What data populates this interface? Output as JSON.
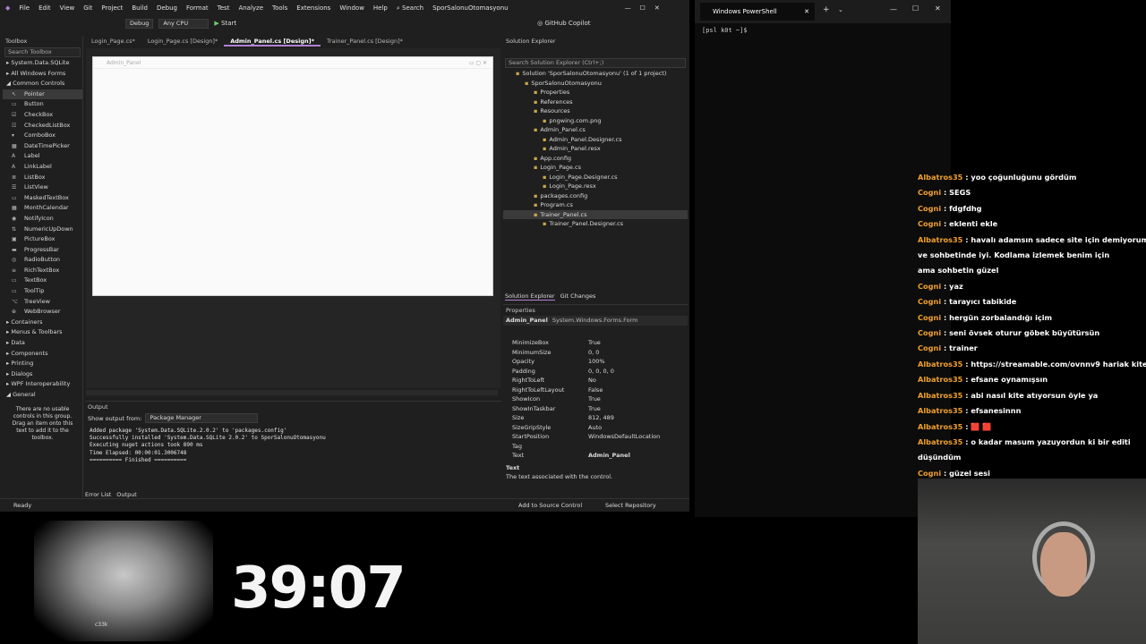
{
  "menu": {
    "items": [
      "File",
      "Edit",
      "View",
      "Git",
      "Project",
      "Build",
      "Debug",
      "Format",
      "Test",
      "Analyze",
      "Tools",
      "Extensions",
      "Window",
      "Help"
    ],
    "search": "Search",
    "solution": "SporSalonuOtomasyonu"
  },
  "toolbar": {
    "config": "Debug",
    "platform": "Any CPU",
    "start": "Start",
    "copilot": "GitHub Copilot"
  },
  "toolbox": {
    "title": "Toolbox",
    "search": "Search Toolbox",
    "categories_top": [
      "System.Data.SQLite",
      "All Windows Forms",
      "Common Controls"
    ],
    "items": [
      "Pointer",
      "Button",
      "CheckBox",
      "CheckedListBox",
      "ComboBox",
      "DateTimePicker",
      "Label",
      "LinkLabel",
      "ListBox",
      "ListView",
      "MaskedTextBox",
      "MonthCalendar",
      "NotifyIcon",
      "NumericUpDown",
      "PictureBox",
      "ProgressBar",
      "RadioButton",
      "RichTextBox",
      "TextBox",
      "ToolTip",
      "TreeView",
      "WebBrowser"
    ],
    "categories_bottom": [
      "Containers",
      "Menus & Toolbars",
      "Data",
      "Components",
      "Printing",
      "Dialogs",
      "WPF Interoperability",
      "General"
    ],
    "empty_msg": "There are no usable controls in this group. Drag an item onto this text to add it to the toolbox."
  },
  "tabs": [
    "Login_Page.cs*",
    "Login_Page.cs [Design]*",
    "Admin_Panel.cs [Design]*",
    "Trainer_Panel.cs [Design]*"
  ],
  "form": {
    "title": "Admin_Panel"
  },
  "output": {
    "title": "Output",
    "show_from_label": "Show output from:",
    "source": "Package Manager",
    "lines": [
      "Added package 'System.Data.SQLite.2.0.2' to 'packages.config'",
      "Successfully installed 'System.Data.SQLite 2.0.2' to SporSalonuOtomasyonu",
      "Executing nuget actions took 890 ms",
      "Time Elapsed: 00:00:01.3006748",
      "========== Finished =========="
    ],
    "bottom_tabs": [
      "Error List",
      "Output"
    ]
  },
  "solution_explorer": {
    "title": "Solution Explorer",
    "search": "Search Solution Explorer (Ctrl+;)",
    "nodes": [
      [
        "Solution 'SporSalonuOtomasyonu' (1 of 1 project)",
        1
      ],
      [
        "SporSalonuOtomasyonu",
        2
      ],
      [
        "Properties",
        3
      ],
      [
        "References",
        3
      ],
      [
        "Resources",
        3
      ],
      [
        "pngwing.com.png",
        4
      ],
      [
        "Admin_Panel.cs",
        3
      ],
      [
        "Admin_Panel.Designer.cs",
        4
      ],
      [
        "Admin_Panel.resx",
        4
      ],
      [
        "App.config",
        3
      ],
      [
        "Login_Page.cs",
        3
      ],
      [
        "Login_Page.Designer.cs",
        4
      ],
      [
        "Login_Page.resx",
        4
      ],
      [
        "packages.config",
        3
      ],
      [
        "Program.cs",
        3
      ],
      [
        "Trainer_Panel.cs",
        3
      ],
      [
        "Trainer_Panel.Designer.cs",
        4
      ]
    ],
    "bottom_tabs": [
      "Solution Explorer",
      "Git Changes"
    ]
  },
  "properties": {
    "title": "Properties",
    "object": "Admin_Panel",
    "type": "System.Windows.Forms.Form",
    "rows": [
      [
        "MinimizeBox",
        "True"
      ],
      [
        "MinimumSize",
        "0, 0"
      ],
      [
        "Opacity",
        "100%"
      ],
      [
        "Padding",
        "0, 0, 0, 0"
      ],
      [
        "RightToLeft",
        "No"
      ],
      [
        "RightToLeftLayout",
        "False"
      ],
      [
        "ShowIcon",
        "True"
      ],
      [
        "ShowInTaskbar",
        "True"
      ],
      [
        "Size",
        "812, 489"
      ],
      [
        "SizeGripStyle",
        "Auto"
      ],
      [
        "StartPosition",
        "WindowsDefaultLocation"
      ],
      [
        "Tag",
        ""
      ],
      [
        "Text",
        "Admin_Panel"
      ]
    ],
    "desc_title": "Text",
    "desc": "The text associated with the control."
  },
  "status": {
    "ready": "Ready",
    "source_control": "Add to Source Control",
    "repo": "Select Repository"
  },
  "powershell": {
    "title": "Windows PowerShell",
    "prompt": "[psl k0t ~]$"
  },
  "chat": [
    [
      "Albatros35",
      "yoo çoğunluğunu gördüm"
    ],
    [
      "Cogni",
      "SEGS"
    ],
    [
      "Cogni",
      "fdgfdhg"
    ],
    [
      "Cogni",
      "eklenti ekle"
    ],
    [
      "Albatros35",
      "havalı adamsın sadece site için demiyorum"
    ],
    [
      "",
      "ve sohbetinde iyi. Kodlama izlemek benim için"
    ],
    [
      "",
      "ama sohbetin güzel"
    ],
    [
      "Cogni",
      "yaz"
    ],
    [
      "Cogni",
      "tarayıcı tabikide"
    ],
    [
      "Cogni",
      "hergün zorbalandığı içim"
    ],
    [
      "Cogni",
      "seni övsek oturur göbek büyütürsün"
    ],
    [
      "Cogni",
      "trainer"
    ],
    [
      "Albatros35",
      "https://streamable.com/ovnnv9 hariak kite"
    ],
    [
      "Albatros35",
      "efsane oynamışsın"
    ],
    [
      "Albatros35",
      "abi nasıl kite atıyorsun öyle ya"
    ],
    [
      "Albatros35",
      "efsanesinnn"
    ],
    [
      "Albatros35",
      "🟥 🟥"
    ],
    [
      "Albatros35",
      "o kadar masum yazuyordun ki bir editi"
    ],
    [
      "",
      "düşündüm"
    ],
    [
      "Cogni",
      "güzel sesi"
    ]
  ],
  "timer": "39:07",
  "anime_label": "c33k"
}
